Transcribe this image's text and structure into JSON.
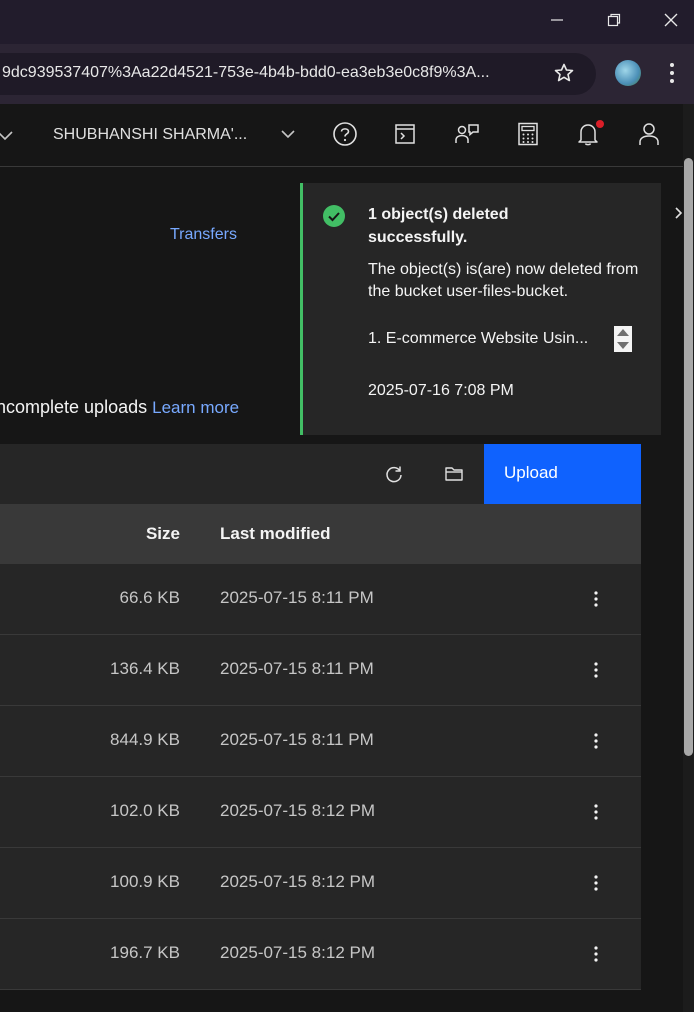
{
  "browser": {
    "url": "9dc939537407%3Aa22d4521-753e-4b4b-bdd0-ea3eb3e0c8f9%3A...",
    "icons": [
      "minimize-icon",
      "restore-icon",
      "close-icon",
      "bookmark-star-icon",
      "profile-avatar",
      "browser-menu-icon"
    ]
  },
  "header": {
    "account_name": "SHUBHANSHI SHARMA'...",
    "icons": [
      "help-icon",
      "cloud-shell-icon",
      "manage-access-icon",
      "cost-estimator-icon",
      "notifications-icon",
      "user-profile-icon"
    ]
  },
  "page": {
    "transfers_link": "Transfers",
    "incomplete_text": "ncomplete uploads",
    "learn_more": "Learn more"
  },
  "toast": {
    "title": "1 object(s) deleted successfully.",
    "body": "The object(s) is(are) now deleted from the bucket user-files-bucket.",
    "item": "1. E-commerce Website Usin...",
    "timestamp": "2025-07-16 7:08 PM",
    "status_color": "#42be65"
  },
  "toolbar": {
    "upload_label": "Upload",
    "accent": "#0f62fe"
  },
  "table": {
    "columns": {
      "size": "Size",
      "modified": "Last modified"
    },
    "rows": [
      {
        "size": "66.6 KB",
        "modified": "2025-07-15 8:11 PM"
      },
      {
        "size": "136.4 KB",
        "modified": "2025-07-15 8:11 PM"
      },
      {
        "size": "844.9 KB",
        "modified": "2025-07-15 8:11 PM"
      },
      {
        "size": "102.0 KB",
        "modified": "2025-07-15 8:12 PM"
      },
      {
        "size": "100.9 KB",
        "modified": "2025-07-15 8:12 PM"
      },
      {
        "size": "196.7 KB",
        "modified": "2025-07-15 8:12 PM"
      }
    ]
  }
}
